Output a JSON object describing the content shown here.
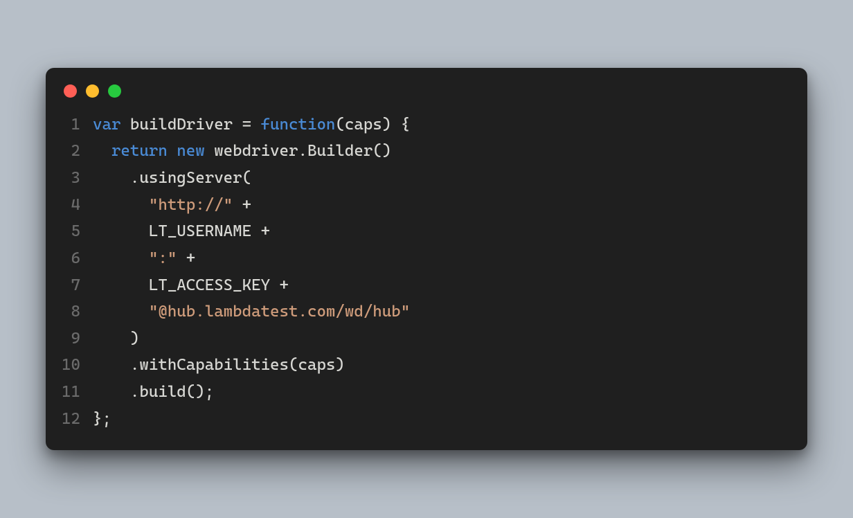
{
  "traffic_lights": {
    "red": "#ff5f56",
    "yellow": "#ffbd2e",
    "green": "#27c93f"
  },
  "code": {
    "lines": [
      {
        "n": "1",
        "tokens": [
          [
            "kw",
            "var "
          ],
          [
            "def",
            "buildDriver = "
          ],
          [
            "kw",
            "function"
          ],
          [
            "def",
            "(caps) {"
          ]
        ]
      },
      {
        "n": "2",
        "tokens": [
          [
            "def",
            "  "
          ],
          [
            "kw",
            "return new"
          ],
          [
            "def",
            " webdriver.Builder()"
          ]
        ]
      },
      {
        "n": "3",
        "tokens": [
          [
            "def",
            "    .usingServer("
          ]
        ]
      },
      {
        "n": "4",
        "tokens": [
          [
            "def",
            "      "
          ],
          [
            "str",
            "\"http://\""
          ],
          [
            "def",
            " +"
          ]
        ]
      },
      {
        "n": "5",
        "tokens": [
          [
            "def",
            "      LT_USERNAME +"
          ]
        ]
      },
      {
        "n": "6",
        "tokens": [
          [
            "def",
            "      "
          ],
          [
            "str",
            "\":\""
          ],
          [
            "def",
            " +"
          ]
        ]
      },
      {
        "n": "7",
        "tokens": [
          [
            "def",
            "      LT_ACCESS_KEY +"
          ]
        ]
      },
      {
        "n": "8",
        "tokens": [
          [
            "def",
            "      "
          ],
          [
            "str",
            "\"@hub.lambdatest.com/wd/hub\""
          ]
        ]
      },
      {
        "n": "9",
        "tokens": [
          [
            "def",
            "    )"
          ]
        ]
      },
      {
        "n": "10",
        "tokens": [
          [
            "def",
            "    .withCapabilities(caps)"
          ]
        ]
      },
      {
        "n": "11",
        "tokens": [
          [
            "def",
            "    .build();"
          ]
        ]
      },
      {
        "n": "12",
        "tokens": [
          [
            "def",
            "};"
          ]
        ]
      }
    ]
  }
}
